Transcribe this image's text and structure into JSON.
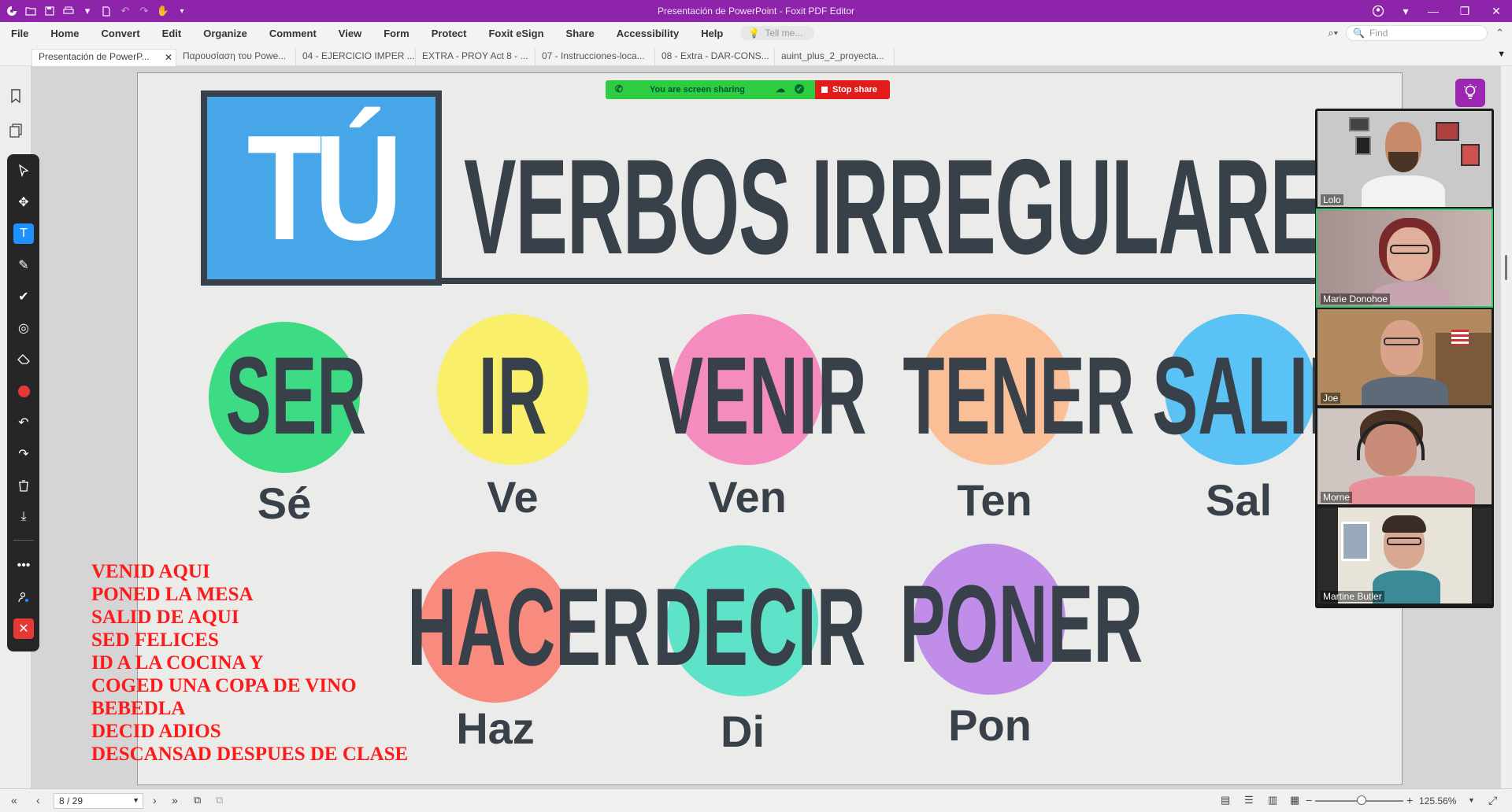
{
  "window": {
    "title": "Presentación de PowerPoint - Foxit PDF Editor"
  },
  "menu": {
    "items": [
      "File",
      "Home",
      "Convert",
      "Edit",
      "Organize",
      "Comment",
      "View",
      "Form",
      "Protect",
      "Foxit eSign",
      "Share",
      "Accessibility",
      "Help"
    ],
    "tell_me_placeholder": "Tell me...",
    "find_placeholder": "Find"
  },
  "tabs": [
    {
      "label": "Presentación de PowerP...",
      "active": true
    },
    {
      "label": "Παρουσίαση του Powe..."
    },
    {
      "label": "04 - EJERCICIO IMPER ..."
    },
    {
      "label": "EXTRA - PROY Act 8 - ..."
    },
    {
      "label": "07 - Instrucciones-loca..."
    },
    {
      "label": "08 - Extra - DAR-CONS..."
    },
    {
      "label": "auint_plus_2_proyecta..."
    }
  ],
  "screen_share": {
    "status": "You are screen sharing",
    "stop_label": "Stop share",
    "green": "#2ecc40",
    "red": "#e21b1b"
  },
  "slide": {
    "badge": "TÚ",
    "title": "VERBOS IRREGULARES",
    "verbs": [
      {
        "infinitive": "SER",
        "imperative": "Sé",
        "color": "#3ddc84"
      },
      {
        "infinitive": "IR",
        "imperative": "Ve",
        "color": "#f9ef6a"
      },
      {
        "infinitive": "VENIR",
        "imperative": "Ven",
        "color": "#f58cc0"
      },
      {
        "infinitive": "TENER",
        "imperative": "Ten",
        "color": "#fbbf98"
      },
      {
        "infinitive": "SALIR",
        "imperative": "Sal",
        "color": "#5bc2f5"
      },
      {
        "infinitive": "HACER",
        "imperative": "Haz",
        "color": "#f88a7e"
      },
      {
        "infinitive": "DECIR",
        "imperative": "Di",
        "color": "#5ee3c9"
      },
      {
        "infinitive": "PONER",
        "imperative": "Pon",
        "color": "#c08de8"
      }
    ],
    "annotation_lines": [
      "VENID AQUI",
      "PONED LA MESA",
      "SALID DE AQUI",
      "SED FELICES",
      "ID A LA COCINA Y",
      "COGED UNA COPA DE VINO",
      "BEBEDLA",
      "DECID ADIOS",
      "DESCANSAD DESPUES DE CLASE"
    ]
  },
  "participants": [
    {
      "name": "Lolo"
    },
    {
      "name": "Marie Donohoe",
      "active": true
    },
    {
      "name": "Joe"
    },
    {
      "name": "Morne"
    },
    {
      "name": "Martine Butler"
    }
  ],
  "status": {
    "page": "8 / 29",
    "zoom": "125.56%"
  }
}
